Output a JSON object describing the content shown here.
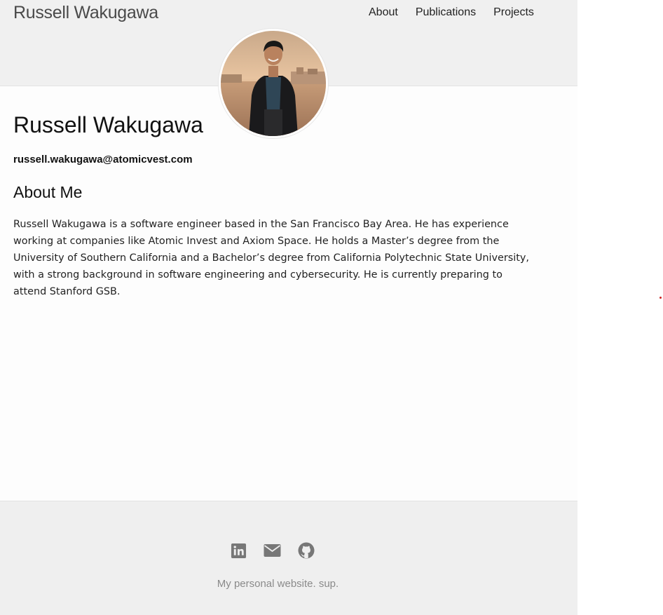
{
  "header": {
    "brand": "Russell Wakugawa",
    "nav": [
      {
        "label": "About"
      },
      {
        "label": "Publications"
      },
      {
        "label": "Projects"
      }
    ]
  },
  "main": {
    "title": "Russell Wakugawa",
    "email": "russell.wakugawa@atomicvest.com",
    "section_title": "About Me",
    "about_text": "Russell Wakugawa is a software engineer based in the San Francisco Bay Area. He has experience working at companies like Atomic Invest and Axiom Space. He holds a Master’s degree from the University of Southern California and a Bachelor’s degree from California Polytechnic State University, with a strong background in software engineering and cybersecurity. He is currently preparing to attend Stanford GSB."
  },
  "footer": {
    "social": [
      {
        "icon": "linkedin-icon"
      },
      {
        "icon": "mail-icon"
      },
      {
        "icon": "github-icon"
      }
    ],
    "text": "My personal website. sup."
  },
  "colors": {
    "header_bg": "#f0f0f0",
    "footer_bg": "#efefef",
    "icon_gray": "#777777",
    "accent_dot": "#cc2222"
  }
}
